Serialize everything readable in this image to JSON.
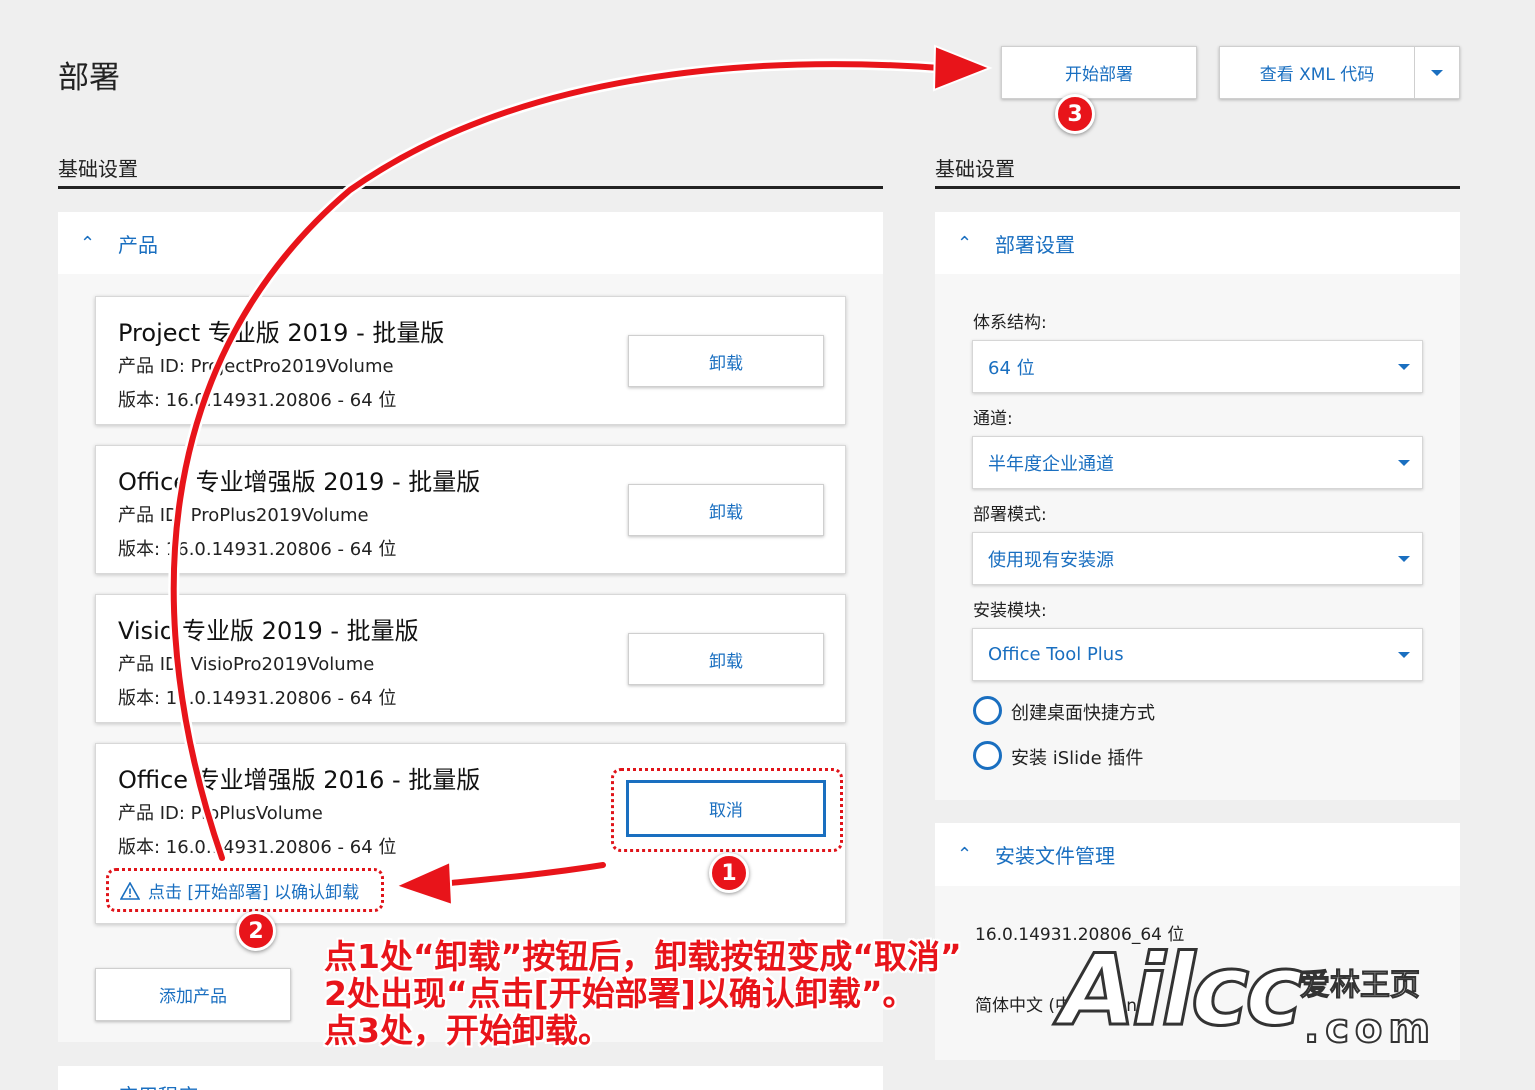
{
  "header": {
    "title": "部署",
    "start_deploy_label": "开始部署",
    "view_xml_label": "查看 XML 代码"
  },
  "left": {
    "section_title": "基础设置",
    "products_panel_label": "产品",
    "products": [
      {
        "title": "Project 专业版 2019 - 批量版",
        "id_line": "产品 ID: ProjectPro2019Volume",
        "version_line": "版本: 16.0.14931.20806 - 64 位",
        "button_label": "卸载"
      },
      {
        "title": "Office 专业增强版 2019 - 批量版",
        "id_line": "产品 ID: ProPlus2019Volume",
        "version_line": "版本: 16.0.14931.20806 - 64 位",
        "button_label": "卸载"
      },
      {
        "title": "Visio 专业版 2019 - 批量版",
        "id_line": "产品 ID: VisioPro2019Volume",
        "version_line": "版本: 16.0.14931.20806 - 64 位",
        "button_label": "卸载"
      },
      {
        "title": "Office 专业增强版 2016 - 批量版",
        "id_line": "产品 ID: ProPlusVolume",
        "version_line": "版本: 16.0.14931.20806 - 64 位",
        "button_label": "取消",
        "warning": "点击 [开始部署] 以确认卸载"
      }
    ],
    "add_product_label": "添加产品",
    "next_panel_partial": "应用程序"
  },
  "right": {
    "section_title": "基础设置",
    "deploy_panel_label": "部署设置",
    "arch_label": "体系结构:",
    "arch_value": "64 位",
    "channel_label": "通道:",
    "channel_value": "半年度企业通道",
    "mode_label": "部署模式:",
    "mode_value": "使用现有安装源",
    "module_label": "安装模块:",
    "module_value": "Office Tool Plus",
    "option_shortcut": "创建桌面快捷方式",
    "option_islide": "安装 iSlide 插件",
    "files_panel_label": "安装文件管理",
    "file_1": "16.0.14931.20806_64 位",
    "file_2": "简体中文 (中",
    "file_2_tail": "h   n"
  },
  "annotations": {
    "badge_1": "1",
    "badge_2": "2",
    "badge_3": "3",
    "line_1": "点1处“卸载”按钮后，卸载按钮变成“取消”",
    "line_2": "2处出现“点击[开始部署]以确认卸载”。",
    "line_3": "点3处，开始卸载。"
  },
  "watermark": {
    "main": "Ailcc",
    "cn": "爱林王页",
    "dom": ".com"
  },
  "colors": {
    "accent": "#1a6fc0",
    "annotation_red": "#e8141a",
    "background": "#efefef"
  }
}
